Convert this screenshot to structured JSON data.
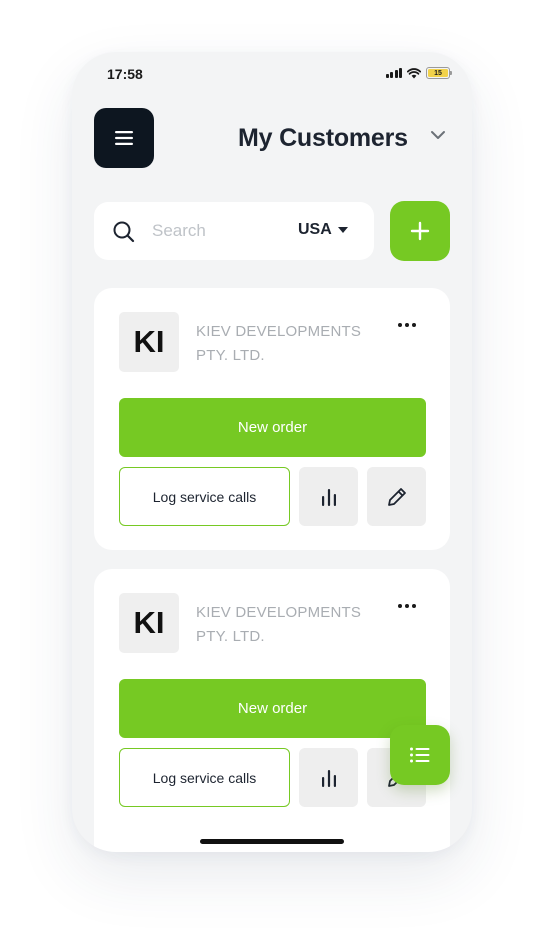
{
  "status_bar": {
    "time": "17:58",
    "battery_level": "15",
    "icons": [
      "signal-icon",
      "wifi-icon",
      "battery-icon"
    ]
  },
  "header": {
    "menu_icon": "hamburger-icon",
    "title": "My Customers",
    "dropdown_icon": "chevron-down-icon"
  },
  "search": {
    "placeholder": "Search",
    "value": "",
    "icon": "search-icon",
    "country": "USA"
  },
  "add_button_icon": "plus-icon",
  "customers": [
    {
      "initials": "KI",
      "name_line1": "KIEV DEVELOPMENTS",
      "name_line2": "PTY. LTD.",
      "new_order_label": "New order",
      "log_calls_label": "Log service calls"
    },
    {
      "initials": "KI",
      "name_line1": "KIEV DEVELOPMENTS",
      "name_line2": "PTY. LTD.",
      "new_order_label": "New order",
      "log_calls_label": "Log service calls"
    }
  ],
  "fab_icon": "list-icon",
  "colors": {
    "accent": "#76c923",
    "dark": "#0d1620",
    "background": "#f3f4f5"
  }
}
